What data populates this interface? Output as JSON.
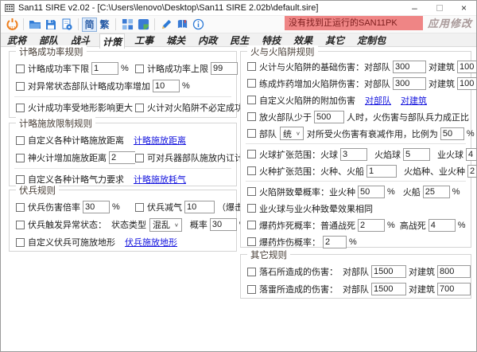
{
  "window": {
    "title": "San11 SIRE v2.02 - [C:\\Users\\lenovo\\Desktop\\San11 SIRE 2.02b\\default.sire]"
  },
  "toolbar": {
    "logo_text": "311",
    "lang_simplified": "简",
    "lang_traditional": "繁",
    "status_banner": "没有找到正运行的SAN11PK",
    "apply_label": "应用修改"
  },
  "tabs": {
    "items": [
      "武将",
      "部队",
      "战斗",
      "计策",
      "工事",
      "城关",
      "内政",
      "民生",
      "特技",
      "效果",
      "其它",
      "定制包"
    ],
    "selected": "计策"
  },
  "ui": {
    "pct": "%",
    "troop": "对部队",
    "building": "对建筑"
  },
  "left": {
    "g1": {
      "title": "计略成功率规则",
      "lower_label": "计略成功率下限",
      "lower_value": "1",
      "upper_label": "计略成功率上限",
      "upper_value": "99",
      "abnormal_label": "对异常状态部队计略成功率增加",
      "abnormal_value": "10",
      "terrain_label": "火计成功率受地形影响更大",
      "trap_label": "火计对火陷阱不必定成功"
    },
    "g2": {
      "title": "计略施放限制规则",
      "custom_range_label": "自定义各种计略施放距离",
      "custom_range_link": "计略施放距离",
      "fire_range_label": "神火计增加施放距离",
      "fire_range_value": "2",
      "weapon_label": "可对兵器部队施放内讧计略",
      "energy_label": "自定义各种计略气力要求",
      "energy_link": "计略施放耗气"
    },
    "g3": {
      "title": "伏兵规则",
      "damage_label": "伏兵伤害倍率",
      "damage_value": "30",
      "energy_label": "伏兵减气",
      "energy_value": "10",
      "energy_suffix": "（爆击加倍）",
      "status_label": "伏兵触发异常状态：",
      "status_type_label": "状态类型",
      "status_select": "混乱",
      "prob_label": "概率",
      "prob_value": "30",
      "terrain_label": "自定义伏兵可施放地形",
      "terrain_link": "伏兵施放地形"
    }
  },
  "right": {
    "g1": {
      "title": "火与火陷阱规则",
      "r1_label": "火计与火陷阱的基础伤害：",
      "r1_troop": "300",
      "r1_building": "100",
      "r2_label": "练成炸药增加火陷阱伤害：",
      "r2_troop": "300",
      "r2_building": "100",
      "r3_label": "自定义火陷阱的附加伤害",
      "r4_label": "放火部队少于",
      "r4_value": "500",
      "r4_suffix": "人时，火伤害与部队兵力成正比",
      "r5_label": "部队",
      "r5_select": "统",
      "r5_mid": "对所受火伤害有衰减作用，比例为",
      "r5_value": "50",
      "r6_label": "火球扩张范围：火球",
      "r6_v1": "3",
      "r6_l2": "火焰球",
      "r6_v2": "5",
      "r6_l3": "业火球",
      "r6_v3": "4",
      "r7_label": "火种扩张范围：火种、火船",
      "r7_v1": "1",
      "r7_l2": "火焰种、业火种",
      "r7_v2": "2",
      "r8_label": "火陷阱致晕概率：业火种",
      "r8_v1": "50",
      "r8_l2": "火船",
      "r8_v2": "25",
      "r9_label": "业火球与业火种致晕效果相同",
      "r10_label": "爆药炸死概率：普通战死",
      "r10_v1": "2",
      "r10_l2": "高战死",
      "r10_v2": "4",
      "r11_label": "爆药炸伤概率：",
      "r11_v": "2"
    },
    "g2": {
      "title": "其它规则",
      "r1_label": "落石所造成的伤害：",
      "r1_troop": "1500",
      "r1_building": "800",
      "r2_label": "落雷所造成的伤害：",
      "r2_troop": "1500",
      "r2_building": "700"
    }
  }
}
